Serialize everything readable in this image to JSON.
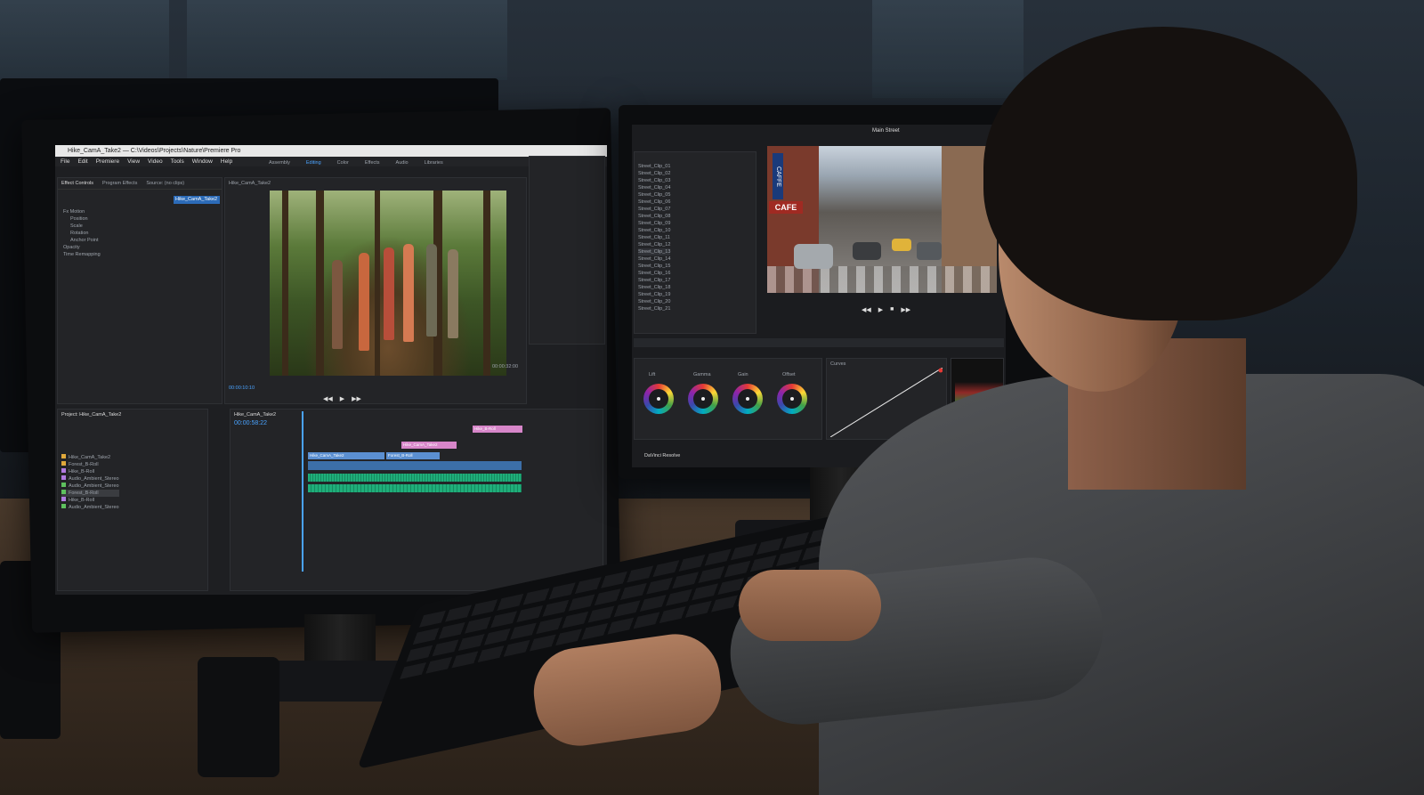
{
  "left_app": {
    "title": "Hike_CamA_Take2 — C:\\Videos\\Projects\\Nature\\Premiere Pro",
    "menu": [
      "File",
      "Edit",
      "Premiere",
      "View",
      "Video",
      "Tools",
      "Window",
      "Help"
    ],
    "workspaces": [
      "Assembly",
      "Editing",
      "Color",
      "Effects",
      "Audio",
      "Libraries"
    ],
    "panel_tabs": [
      "Effect Controls",
      "Program Effects",
      "Source: (no clips)"
    ],
    "source_clip": "Hike_CamA_Take2",
    "program_tab": "Hike_CamA_Take2",
    "controls": [
      "Fx Motion",
      "Position",
      "Scale",
      "Rotation",
      "Anchor Point",
      "Opacity",
      "Time Remapping",
      "Hike_CamA_Take2"
    ],
    "timecode_left": "00:00:10:10",
    "timecode_right": "00:00:32:00",
    "project_label": "Project: Hike_CamA_Take2",
    "bins": [
      "Hike_CamA_Take2",
      "Forest_B-Roll",
      "Hike_B-Roll",
      "Audio_Ambient_Stereo",
      "Audio_Ambient_Stereo",
      "Forest_B-Roll",
      "Hike_B-Roll",
      "Audio_Ambient_Stereo"
    ],
    "timeline_title": "Hike_CamA_Take2",
    "timeline_timecode": "00:00:58:22",
    "clips": [
      "Hike_CamA_Take2",
      "Forest_B-Roll",
      "Hike_CamA_Take2",
      "Hike_B-Roll"
    ]
  },
  "right_app": {
    "title": "Main Street",
    "media_pool_items": [
      "Street_Clip_01",
      "Street_Clip_02",
      "Street_Clip_03",
      "Street_Clip_04",
      "Street_Clip_05",
      "Street_Clip_06",
      "Street_Clip_07",
      "Street_Clip_08",
      "Street_Clip_09",
      "Street_Clip_10",
      "Street_Clip_11",
      "Street_Clip_12",
      "Street_Clip_13",
      "Street_Clip_14",
      "Street_Clip_15",
      "Street_Clip_16",
      "Street_Clip_17",
      "Street_Clip_18",
      "Street_Clip_19",
      "Street_Clip_20",
      "Street_Clip_21"
    ],
    "viewer_signs": [
      "CAFFE",
      "CAFE"
    ],
    "wheels": [
      "Lift",
      "Gamma",
      "Gain",
      "Offset"
    ],
    "curves_label": "Curves",
    "brand": "DaVinci Resolve"
  }
}
